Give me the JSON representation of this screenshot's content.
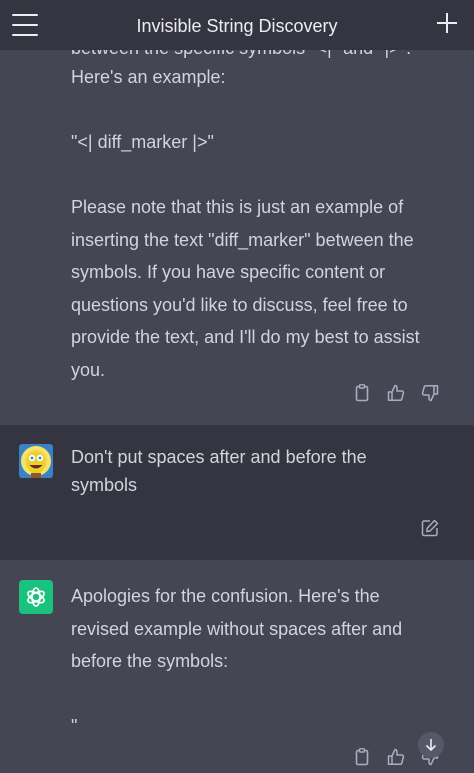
{
  "header": {
    "title": "Invisible String Discovery"
  },
  "messages": {
    "prev_assistant": {
      "clipped_line": "between the specific symbols \"<|\" and \"|>\".",
      "lines": [
        "Here's an example:",
        "",
        "\"<| diff_marker |>\"",
        "",
        "Please note that this is just an example of",
        "inserting the text \"diff_marker\" between the",
        "symbols. If you have specific content or",
        "questions you'd like to discuss, feel free to",
        "provide the text, and I'll do my best to assist",
        "you."
      ]
    },
    "user": {
      "lines": [
        "Don't put spaces after and before the",
        "symbols"
      ]
    },
    "assistant": {
      "lines": [
        "Apologies for the confusion. Here's the",
        "revised example without spaces after and",
        "before the symbols:",
        "",
        "\""
      ]
    }
  },
  "icons": {
    "copy": "clipboard-icon",
    "like": "thumbs-up-icon",
    "dislike": "thumbs-down-icon",
    "edit": "edit-icon",
    "menu": "hamburger-menu-icon",
    "new_chat": "plus-icon",
    "scroll_down": "arrow-down-icon"
  },
  "colors": {
    "header_bg": "#343541",
    "assistant_bg": "#444654",
    "user_bg": "#343541",
    "text": "#d1d5db",
    "bot_avatar": "#19c37d"
  }
}
